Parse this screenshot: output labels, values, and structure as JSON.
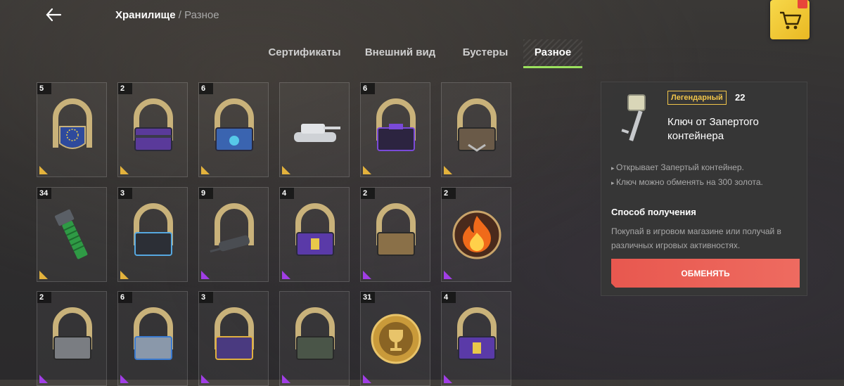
{
  "header": {
    "breadcrumb_current": "Хранилище",
    "breadcrumb_sep": " / ",
    "breadcrumb_sub": "Разное",
    "back_icon": "arrow-left-icon",
    "shop_icon": "cart-icon"
  },
  "tabs": [
    {
      "label": "Сертификаты",
      "active": false
    },
    {
      "label": "Внешний вид",
      "active": false
    },
    {
      "label": "Бустеры",
      "active": false
    },
    {
      "label": "Разное",
      "active": true
    }
  ],
  "items": [
    {
      "count": "5",
      "icon": "horseshoe-eu-badge-icon",
      "rarity": "gold"
    },
    {
      "count": "2",
      "icon": "horseshoe-purple-container-icon",
      "rarity": "gold"
    },
    {
      "count": "6",
      "icon": "horseshoe-blue-container-icon",
      "rarity": "gold"
    },
    {
      "count": "",
      "icon": "tank-icon",
      "rarity": "gold"
    },
    {
      "count": "6",
      "icon": "horseshoe-dark-purple-container-icon",
      "rarity": "gold"
    },
    {
      "count": "",
      "icon": "horseshoe-brown-container-icon",
      "rarity": "gold"
    },
    {
      "count": "34",
      "icon": "green-bolt-icon",
      "rarity": "gold"
    },
    {
      "count": "3",
      "icon": "horseshoe-black-container-icon",
      "rarity": "gold"
    },
    {
      "count": "9",
      "icon": "horseshoe-tank-icon",
      "rarity": "purple"
    },
    {
      "count": "4",
      "icon": "horseshoe-lock-container-icon",
      "rarity": "purple"
    },
    {
      "count": "2",
      "icon": "horseshoe-wooden-container-icon",
      "rarity": "purple"
    },
    {
      "count": "2",
      "icon": "fire-badge-icon",
      "rarity": "purple"
    },
    {
      "count": "2",
      "icon": "horseshoe-grey-container-icon",
      "rarity": "purple"
    },
    {
      "count": "6",
      "icon": "horseshoe-steel-container-icon",
      "rarity": "purple"
    },
    {
      "count": "3",
      "icon": "horseshoe-violet-container-icon",
      "rarity": "purple"
    },
    {
      "count": "",
      "icon": "horseshoe-camo-container-icon",
      "rarity": "purple"
    },
    {
      "count": "31",
      "icon": "gold-trophy-coin-icon",
      "rarity": "purple"
    },
    {
      "count": "4",
      "icon": "horseshoe-lock-container-icon",
      "rarity": "purple"
    }
  ],
  "detail": {
    "rarity_label": "Легендарный",
    "level": "22",
    "title": "Ключ от Запертого контейнера",
    "bullets": [
      "Открывает Запертый контейнер.",
      "Ключ можно обменять на 300 золота."
    ],
    "how_title": "Способ получения",
    "how_text": "Покупай в игровом магазине или получай в различных игровых активностях.",
    "exchange_label": "ОБМЕНЯТЬ"
  },
  "colors": {
    "accent_green": "#9be15d",
    "legendary": "#f0c44a",
    "exchange": "#e8584f",
    "rarity_gold": "#e3b23c",
    "rarity_purple": "#a13ee6"
  }
}
